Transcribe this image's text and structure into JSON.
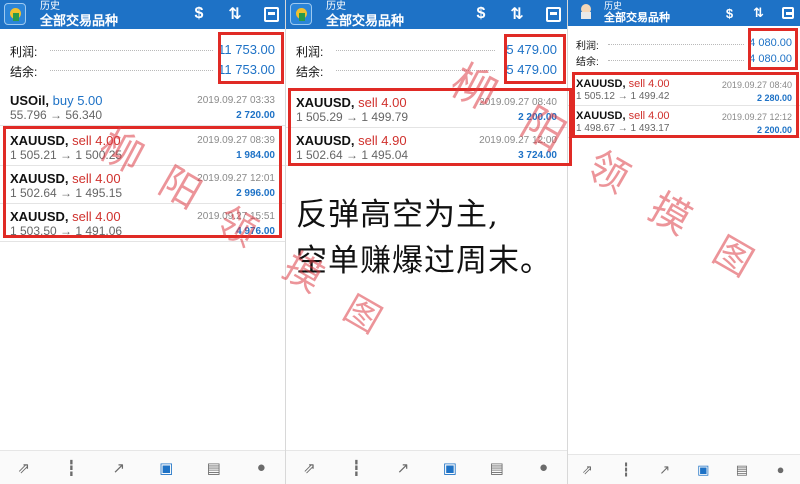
{
  "app": {
    "subtitle": "历史",
    "title": "全部交易品种",
    "toolbar_icons": [
      "currency-dollar-icon",
      "sort-icon",
      "calendar-icon"
    ]
  },
  "panels": [
    {
      "summary": {
        "profit_label": "利润:",
        "profit_value": "11 753.00",
        "balance_label": "结余:",
        "balance_value": "11 753.00"
      },
      "orders": [
        {
          "symbol": "USOil,",
          "side": "buy 5.00",
          "side_type": "buy",
          "time": "2019.09.27 03:33",
          "prices": "55.796 → 56.340",
          "profit": "2 720.00"
        },
        {
          "symbol": "XAUUSD,",
          "side": "sell 4.00",
          "side_type": "sell",
          "time": "2019.09.27 08:39",
          "prices": "1 505.21 → 1 500.25",
          "profit": "1 984.00"
        },
        {
          "symbol": "XAUUSD,",
          "side": "sell 4.00",
          "side_type": "sell",
          "time": "2019.09.27 12:01",
          "prices": "1 502.64 → 1 495.15",
          "profit": "2 996.00"
        },
        {
          "symbol": "XAUUSD,",
          "side": "sell 4.00",
          "side_type": "sell",
          "time": "2019.09.27 15:51",
          "prices": "1 503.50 → 1 491.06",
          "profit": "4 976.00"
        }
      ]
    },
    {
      "summary": {
        "profit_label": "利润:",
        "profit_value": "5 479.00",
        "balance_label": "结余:",
        "balance_value": "5 479.00"
      },
      "orders": [
        {
          "symbol": "XAUUSD,",
          "side": "sell 4.00",
          "side_type": "sell",
          "time": "2019.09.27 08:40",
          "prices": "1 505.29 → 1 499.79",
          "profit": "2 200.00"
        },
        {
          "symbol": "XAUUSD,",
          "side": "sell 4.90",
          "side_type": "sell",
          "time": "2019.09.27 12:00",
          "prices": "1 502.64 → 1 495.04",
          "profit": "3 724.00"
        }
      ]
    },
    {
      "summary": {
        "profit_label": "利润:",
        "profit_value": "4 080.00",
        "balance_label": "结余:",
        "balance_value": "4 080.00"
      },
      "orders": [
        {
          "symbol": "XAUUSD,",
          "side": "sell 4.00",
          "side_type": "sell",
          "time": "2019.09.27 08:40",
          "prices": "1 505.12 → 1 499.42",
          "profit": "2 280.00"
        },
        {
          "symbol": "XAUUSD,",
          "side": "sell 4.00",
          "side_type": "sell",
          "time": "2019.09.27 12:12",
          "prices": "1 498.67 → 1 493.17",
          "profit": "2 200.00"
        }
      ]
    }
  ],
  "bottom_nav": [
    "quotes-icon",
    "chart-icon",
    "trade-icon",
    "history-icon",
    "news-icon",
    "chat-icon"
  ],
  "headline": {
    "line1": "反弹高空为主,",
    "line2": "空单赚爆过周末。"
  },
  "watermark": {
    "chars": [
      "柳",
      "阳",
      "领",
      "摸",
      "图"
    ]
  },
  "colors": {
    "topbar": "#1e72c6",
    "sell": "#d0312d",
    "buy": "#1e72c6",
    "highlight": "#e02a25"
  }
}
